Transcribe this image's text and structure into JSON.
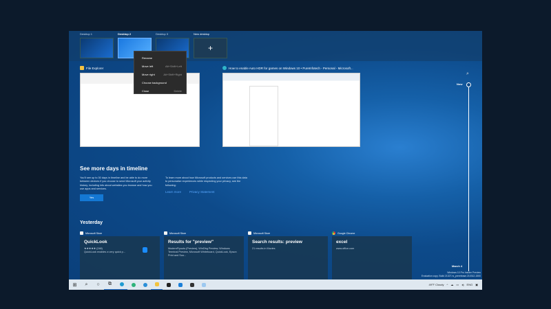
{
  "desktops": [
    {
      "label": "Desktop 1"
    },
    {
      "label": "Desktop 2"
    },
    {
      "label": "Desktop 3"
    },
    {
      "label": "New desktop",
      "icon": "+"
    }
  ],
  "context_menu": [
    {
      "label": "Rename",
      "shortcut": ""
    },
    {
      "label": "Move left",
      "shortcut": "Alt+Shift+Left"
    },
    {
      "label": "Move right",
      "shortcut": "Alt+Shift+Right"
    },
    {
      "label": "Choose background",
      "shortcut": ""
    },
    {
      "label": "Close",
      "shortcut": "Delete"
    }
  ],
  "windows": [
    {
      "title": "File Explorer"
    },
    {
      "title": "How to enable Auto HDR for games on Windows 10 • PureInfotech - Personal - Microsoft..."
    }
  ],
  "timeline_promo": {
    "heading": "See more days in timeline",
    "left_text": "You'll see up to 30 days in timeline and be able to do more between devices if you choose to send Microsoft your activity history, including info about websites you browse and how you use apps and services.",
    "right_text": "To learn more about how Microsoft products and services use this data to personalize experiences while respecting your privacy, see the following:",
    "yes_label": "Yes",
    "learn_more": "Learn more",
    "privacy": "Privacy Statement"
  },
  "yesterday_label": "Yesterday",
  "cards": [
    {
      "source": "Microsoft Store",
      "title": "QuickLook",
      "desc": "★★★★★ (248)",
      "desc2": "QuickLook enables a very quick p..."
    },
    {
      "source": "Microsoft Store",
      "title": "Results for \"preview\"",
      "desc": "ModernFlyouts (Preview), WinDbg Preview, Windows Terminal Preview, Microsoft Whiteboard, QuickLook, Epson Print and Sca...",
      "desc2": ""
    },
    {
      "source": "Microsoft Store",
      "title": "Search results: preview",
      "desc": "21 results in Movies",
      "desc2": ""
    },
    {
      "source": "Google Chrome",
      "title": "excel",
      "desc": "www.office.com",
      "desc2": ""
    }
  ],
  "timeline": {
    "now": "Now",
    "date": "March 4"
  },
  "watermark": {
    "line1": "Windows 10 Pro Insider Preview",
    "line2": "Evaluation copy. Build 21327.rs_prerelease.210312-1500"
  },
  "tray": {
    "weather": "49°F  Cloudy",
    "lang": "ENG"
  }
}
